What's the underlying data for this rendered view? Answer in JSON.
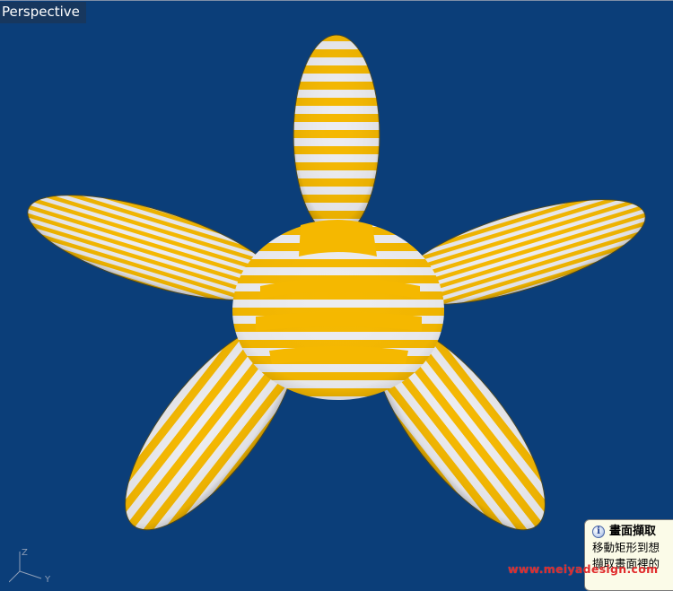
{
  "viewport": {
    "label": "Perspective",
    "background": "#0b3e79"
  },
  "model": {
    "description_colors": {
      "stripe": "#f5b800",
      "base": "#e9e9ef"
    }
  },
  "axis": {
    "z": "Z",
    "y": "Y",
    "x": "X"
  },
  "tooltip": {
    "title": "畫面擷取",
    "line1": "移動矩形到想",
    "line2": "擷取畫面裡的"
  },
  "watermark": {
    "text": "www.meiyadesign.com",
    "color": "#e02b2b"
  }
}
